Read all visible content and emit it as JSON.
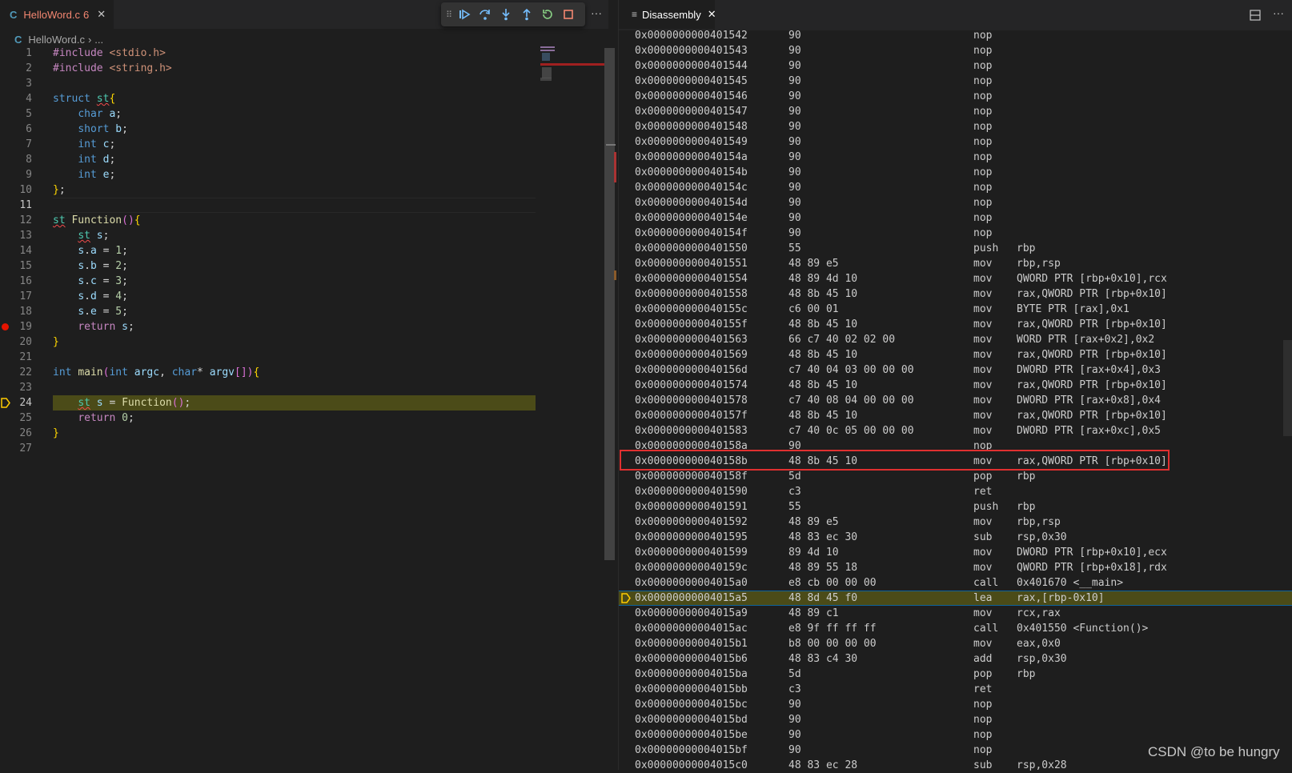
{
  "left_editor": {
    "tab": {
      "title": "HelloWord.c",
      "problem_count": "6",
      "icon": "c-file-icon"
    },
    "breadcrumb": {
      "file": "HelloWord.c",
      "rest": "..."
    },
    "current_line": 24,
    "breakpoint_line": 19,
    "lines": [
      {
        "n": "1",
        "text": "#include <stdio.h>"
      },
      {
        "n": "2",
        "text": "#include <string.h>"
      },
      {
        "n": "3",
        "text": ""
      },
      {
        "n": "4",
        "text": "struct st{"
      },
      {
        "n": "5",
        "text": "    char a;"
      },
      {
        "n": "6",
        "text": "    short b;"
      },
      {
        "n": "7",
        "text": "    int c;"
      },
      {
        "n": "8",
        "text": "    int d;"
      },
      {
        "n": "9",
        "text": "    int e;"
      },
      {
        "n": "10",
        "text": "};"
      },
      {
        "n": "11",
        "text": ""
      },
      {
        "n": "12",
        "text": "st Function(){"
      },
      {
        "n": "13",
        "text": "    st s;"
      },
      {
        "n": "14",
        "text": "    s.a = 1;"
      },
      {
        "n": "15",
        "text": "    s.b = 2;"
      },
      {
        "n": "16",
        "text": "    s.c = 3;"
      },
      {
        "n": "17",
        "text": "    s.d = 4;"
      },
      {
        "n": "18",
        "text": "    s.e = 5;"
      },
      {
        "n": "19",
        "text": "    return s;"
      },
      {
        "n": "20",
        "text": "}"
      },
      {
        "n": "21",
        "text": ""
      },
      {
        "n": "22",
        "text": "int main(int argc, char* argv[]){"
      },
      {
        "n": "23",
        "text": ""
      },
      {
        "n": "24",
        "text": "    st s = Function();"
      },
      {
        "n": "25",
        "text": "    return 0;"
      },
      {
        "n": "26",
        "text": "}"
      },
      {
        "n": "27",
        "text": ""
      }
    ]
  },
  "debug_toolbar": {
    "buttons": [
      "continue-icon",
      "step-over-icon",
      "step-into-icon",
      "step-out-icon",
      "restart-icon",
      "stop-icon"
    ]
  },
  "right_editor": {
    "tab": {
      "title": "Disassembly"
    },
    "rows": [
      {
        "addr": "0x0000000000401542",
        "bytes": "90",
        "instr": "nop",
        "ops": ""
      },
      {
        "addr": "0x0000000000401543",
        "bytes": "90",
        "instr": "nop",
        "ops": ""
      },
      {
        "addr": "0x0000000000401544",
        "bytes": "90",
        "instr": "nop",
        "ops": ""
      },
      {
        "addr": "0x0000000000401545",
        "bytes": "90",
        "instr": "nop",
        "ops": ""
      },
      {
        "addr": "0x0000000000401546",
        "bytes": "90",
        "instr": "nop",
        "ops": ""
      },
      {
        "addr": "0x0000000000401547",
        "bytes": "90",
        "instr": "nop",
        "ops": ""
      },
      {
        "addr": "0x0000000000401548",
        "bytes": "90",
        "instr": "nop",
        "ops": ""
      },
      {
        "addr": "0x0000000000401549",
        "bytes": "90",
        "instr": "nop",
        "ops": ""
      },
      {
        "addr": "0x000000000040154a",
        "bytes": "90",
        "instr": "nop",
        "ops": ""
      },
      {
        "addr": "0x000000000040154b",
        "bytes": "90",
        "instr": "nop",
        "ops": ""
      },
      {
        "addr": "0x000000000040154c",
        "bytes": "90",
        "instr": "nop",
        "ops": ""
      },
      {
        "addr": "0x000000000040154d",
        "bytes": "90",
        "instr": "nop",
        "ops": ""
      },
      {
        "addr": "0x000000000040154e",
        "bytes": "90",
        "instr": "nop",
        "ops": ""
      },
      {
        "addr": "0x000000000040154f",
        "bytes": "90",
        "instr": "nop",
        "ops": ""
      },
      {
        "addr": "0x0000000000401550",
        "bytes": "55",
        "instr": "push",
        "ops": "rbp"
      },
      {
        "addr": "0x0000000000401551",
        "bytes": "48 89 e5",
        "instr": "mov",
        "ops": "rbp,rsp"
      },
      {
        "addr": "0x0000000000401554",
        "bytes": "48 89 4d 10",
        "instr": "mov",
        "ops": "QWORD PTR [rbp+0x10],rcx"
      },
      {
        "addr": "0x0000000000401558",
        "bytes": "48 8b 45 10",
        "instr": "mov",
        "ops": "rax,QWORD PTR [rbp+0x10]"
      },
      {
        "addr": "0x000000000040155c",
        "bytes": "c6 00 01",
        "instr": "mov",
        "ops": "BYTE PTR [rax],0x1"
      },
      {
        "addr": "0x000000000040155f",
        "bytes": "48 8b 45 10",
        "instr": "mov",
        "ops": "rax,QWORD PTR [rbp+0x10]"
      },
      {
        "addr": "0x0000000000401563",
        "bytes": "66 c7 40 02 02 00",
        "instr": "mov",
        "ops": "WORD PTR [rax+0x2],0x2"
      },
      {
        "addr": "0x0000000000401569",
        "bytes": "48 8b 45 10",
        "instr": "mov",
        "ops": "rax,QWORD PTR [rbp+0x10]"
      },
      {
        "addr": "0x000000000040156d",
        "bytes": "c7 40 04 03 00 00 00",
        "instr": "mov",
        "ops": "DWORD PTR [rax+0x4],0x3"
      },
      {
        "addr": "0x0000000000401574",
        "bytes": "48 8b 45 10",
        "instr": "mov",
        "ops": "rax,QWORD PTR [rbp+0x10]"
      },
      {
        "addr": "0x0000000000401578",
        "bytes": "c7 40 08 04 00 00 00",
        "instr": "mov",
        "ops": "DWORD PTR [rax+0x8],0x4"
      },
      {
        "addr": "0x000000000040157f",
        "bytes": "48 8b 45 10",
        "instr": "mov",
        "ops": "rax,QWORD PTR [rbp+0x10]"
      },
      {
        "addr": "0x0000000000401583",
        "bytes": "c7 40 0c 05 00 00 00",
        "instr": "mov",
        "ops": "DWORD PTR [rax+0xc],0x5"
      },
      {
        "addr": "0x000000000040158a",
        "bytes": "90",
        "instr": "nop",
        "ops": ""
      },
      {
        "addr": "0x000000000040158b",
        "bytes": "48 8b 45 10",
        "instr": "mov",
        "ops": "rax,QWORD PTR [rbp+0x10]"
      },
      {
        "addr": "0x000000000040158f",
        "bytes": "5d",
        "instr": "pop",
        "ops": "rbp"
      },
      {
        "addr": "0x0000000000401590",
        "bytes": "c3",
        "instr": "ret",
        "ops": ""
      },
      {
        "addr": "0x0000000000401591",
        "bytes": "55",
        "instr": "push",
        "ops": "rbp"
      },
      {
        "addr": "0x0000000000401592",
        "bytes": "48 89 e5",
        "instr": "mov",
        "ops": "rbp,rsp"
      },
      {
        "addr": "0x0000000000401595",
        "bytes": "48 83 ec 30",
        "instr": "sub",
        "ops": "rsp,0x30"
      },
      {
        "addr": "0x0000000000401599",
        "bytes": "89 4d 10",
        "instr": "mov",
        "ops": "DWORD PTR [rbp+0x10],ecx"
      },
      {
        "addr": "0x000000000040159c",
        "bytes": "48 89 55 18",
        "instr": "mov",
        "ops": "QWORD PTR [rbp+0x18],rdx"
      },
      {
        "addr": "0x00000000004015a0",
        "bytes": "e8 cb 00 00 00",
        "instr": "call",
        "ops": "0x401670 <__main>"
      },
      {
        "addr": "0x00000000004015a5",
        "bytes": "48 8d 45 f0",
        "instr": "lea",
        "ops": "rax,[rbp-0x10]"
      },
      {
        "addr": "0x00000000004015a9",
        "bytes": "48 89 c1",
        "instr": "mov",
        "ops": "rcx,rax"
      },
      {
        "addr": "0x00000000004015ac",
        "bytes": "e8 9f ff ff ff",
        "instr": "call",
        "ops": "0x401550 <Function()>"
      },
      {
        "addr": "0x00000000004015b1",
        "bytes": "b8 00 00 00 00",
        "instr": "mov",
        "ops": "eax,0x0"
      },
      {
        "addr": "0x00000000004015b6",
        "bytes": "48 83 c4 30",
        "instr": "add",
        "ops": "rsp,0x30"
      },
      {
        "addr": "0x00000000004015ba",
        "bytes": "5d",
        "instr": "pop",
        "ops": "rbp"
      },
      {
        "addr": "0x00000000004015bb",
        "bytes": "c3",
        "instr": "ret",
        "ops": ""
      },
      {
        "addr": "0x00000000004015bc",
        "bytes": "90",
        "instr": "nop",
        "ops": ""
      },
      {
        "addr": "0x00000000004015bd",
        "bytes": "90",
        "instr": "nop",
        "ops": ""
      },
      {
        "addr": "0x00000000004015be",
        "bytes": "90",
        "instr": "nop",
        "ops": ""
      },
      {
        "addr": "0x00000000004015bf",
        "bytes": "90",
        "instr": "nop",
        "ops": ""
      },
      {
        "addr": "0x00000000004015c0",
        "bytes": "48 83 ec 28",
        "instr": "sub",
        "ops": "rsp,0x28"
      }
    ],
    "current_addr": "0x00000000004015a5",
    "boxed_addr": "0x000000000040158b"
  },
  "watermark": "CSDN @to be hungry",
  "colors": {
    "current_line_bg": "#4b4b18",
    "breakpoint": "#e51400",
    "annotation_box": "#e03030"
  }
}
